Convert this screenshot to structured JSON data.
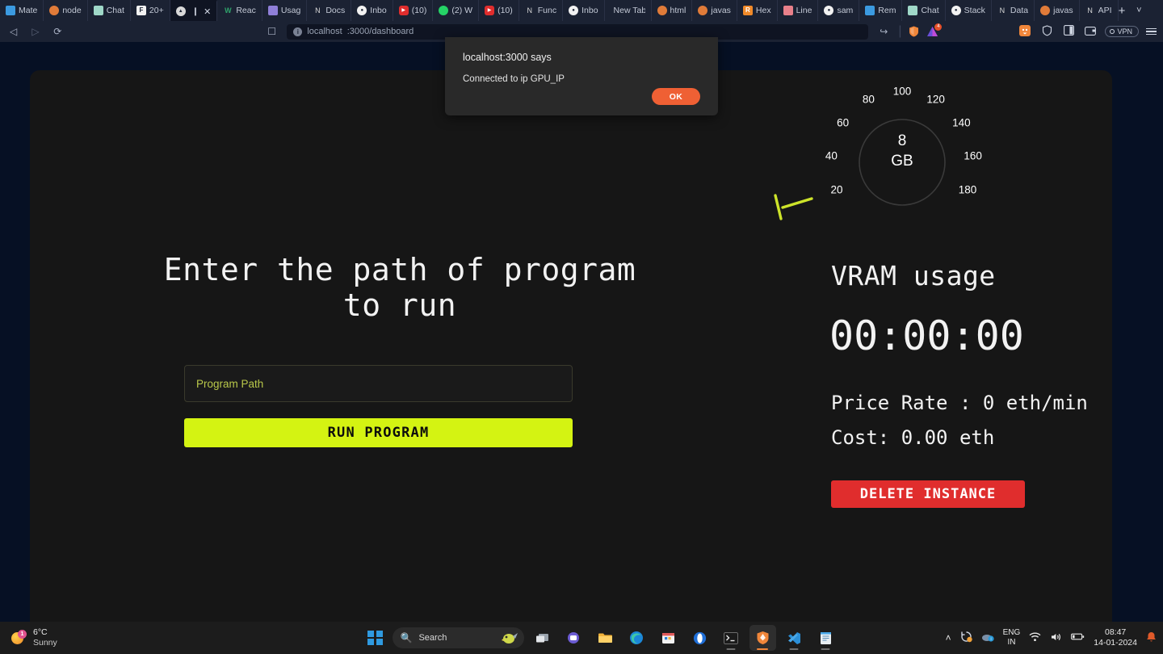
{
  "browser": {
    "tabs": [
      {
        "label": "Mate",
        "favicon": "mui-icon",
        "color": "#3b9ae0",
        "active": false
      },
      {
        "label": "node",
        "favicon": "java-icon",
        "color": "#e07b39",
        "active": false
      },
      {
        "label": "Chat",
        "favicon": "whatsapp-desktop-icon",
        "color": "#9fd8c8",
        "active": false
      },
      {
        "label": "20+ ",
        "favicon": "figma-icon",
        "color": "#f2f2f2",
        "active": false
      },
      {
        "label": "",
        "favicon": "brave-triangle-icon",
        "color": "#d8d8d8",
        "active": true
      },
      {
        "label": "Reac",
        "favicon": "w3-icon",
        "color": "#2fa36b",
        "active": false
      },
      {
        "label": "Usag",
        "favicon": "react-atom-icon",
        "color": "#8f7fd8",
        "active": false
      },
      {
        "label": "Docs",
        "favicon": "notion-icon",
        "color": "#d8d8d8",
        "active": false
      },
      {
        "label": "Inbo",
        "favicon": "github-icon",
        "color": "#f2f2f2",
        "active": false
      },
      {
        "label": "(10) ",
        "favicon": "youtube-icon",
        "color": "#e02d2d",
        "active": false
      },
      {
        "label": "(2) W",
        "favicon": "whatsapp-icon",
        "color": "#25d366",
        "active": false
      },
      {
        "label": "(10) ",
        "favicon": "youtube-icon",
        "color": "#e02d2d",
        "active": false
      },
      {
        "label": "Func",
        "favicon": "notion-icon",
        "color": "#d8d8d8",
        "active": false
      },
      {
        "label": "Inbo",
        "favicon": "github-icon",
        "color": "#f2f2f2",
        "active": false
      },
      {
        "label": "New Tab",
        "favicon": "none",
        "color": "#00000000",
        "active": false
      },
      {
        "label": "html",
        "favicon": "java-icon",
        "color": "#e07b39",
        "active": false
      },
      {
        "label": "javas",
        "favicon": "java-icon",
        "color": "#e07b39",
        "active": false
      },
      {
        "label": "Hex ",
        "favicon": "r-icon",
        "color": "#f08a2a",
        "active": false
      },
      {
        "label": "Line",
        "favicon": "line-icon",
        "color": "#e8808a",
        "active": false
      },
      {
        "label": "sam",
        "favicon": "github-icon",
        "color": "#f2f2f2",
        "active": false
      },
      {
        "label": "Rem",
        "favicon": "remix-icon",
        "color": "#3b9ae0",
        "active": false
      },
      {
        "label": "Chat",
        "favicon": "whatsapp-desktop-icon",
        "color": "#9fd8c8",
        "active": false
      },
      {
        "label": "Stack",
        "favicon": "github-icon",
        "color": "#f2f2f2",
        "active": false
      },
      {
        "label": "Data",
        "favicon": "notion-icon",
        "color": "#d8d8d8",
        "active": false
      },
      {
        "label": "javas",
        "favicon": "java-icon",
        "color": "#e07b39",
        "active": false
      },
      {
        "label": "API ",
        "favicon": "notion-icon",
        "color": "#d8d8d8",
        "active": false
      }
    ],
    "new_tab_label": "+",
    "window_controls": {
      "chevron": "˅",
      "minimize": "–",
      "maximize": "❐",
      "close": "✕"
    },
    "nav": {
      "back": "◁",
      "forward": "▷",
      "reload": "⟳",
      "bookmark": "☐"
    },
    "url": {
      "host": "localhost",
      "path": ":3000/dashboard",
      "full": "localhost:3000/dashboard"
    },
    "toolbar": {
      "share_icon": "share-icon",
      "shield_label": "brave-shield-icon",
      "extension_badge": "4",
      "leo_icon": "brave-leo-icon",
      "sidebar_icon": "sidebar-icon",
      "wallet_icon": "wallet-icon",
      "vpn_label": "VPN",
      "menu_icon": "hamburger-menu-icon"
    }
  },
  "dialog": {
    "title": "localhost:3000 says",
    "message": "Connected to ip GPU_IP",
    "ok_label": "OK",
    "accent": "#ef6034"
  },
  "main": {
    "headline": "Enter the path of program to run",
    "input_placeholder": "Program Path",
    "input_value": "",
    "run_button": "RUN PROGRAM",
    "accent": "#d4f312"
  },
  "panel": {
    "vram_title": "VRAM usage",
    "timer": "00:00:00",
    "price_rate": "Price Rate : 0 eth/min",
    "cost": "Cost: 0.00 eth",
    "delete_button": "DELETE INSTANCE",
    "delete_color": "#e02d2d"
  },
  "chart_data": {
    "type": "gauge",
    "title": "VRAM usage",
    "center_value": "8",
    "center_unit": "GB",
    "value": 8,
    "min": 0,
    "max": 200,
    "tick_labels": [
      "20",
      "40",
      "60",
      "80",
      "100",
      "120",
      "140",
      "160",
      "180"
    ],
    "tick_values": [
      20,
      40,
      60,
      80,
      100,
      120,
      140,
      160,
      180
    ],
    "needle_color": "#cde32a",
    "ring_color": "#3a3a3a",
    "label_color": "#ffffff",
    "legend": "none",
    "grid": false
  },
  "taskbar": {
    "weather": {
      "temp": "6°C",
      "condition": "Sunny",
      "badge": "1"
    },
    "start_label": "start-button",
    "search_placeholder": "Search",
    "apps": [
      {
        "name": "task-view-icon"
      },
      {
        "name": "teams-icon"
      },
      {
        "name": "file-explorer-icon"
      },
      {
        "name": "edge-icon"
      },
      {
        "name": "microsoft-store-icon"
      },
      {
        "name": "opera-icon"
      },
      {
        "name": "terminal-icon"
      },
      {
        "name": "brave-icon"
      },
      {
        "name": "vscode-icon"
      },
      {
        "name": "notepad-icon"
      }
    ],
    "tray": {
      "chevron": "˄",
      "language_line1": "ENG",
      "language_line2": "IN",
      "wifi": "wifi-icon",
      "volume": "volume-icon",
      "battery": "battery-icon",
      "time": "08:47",
      "date": "14-01-2024",
      "notification": "bell-icon"
    }
  }
}
